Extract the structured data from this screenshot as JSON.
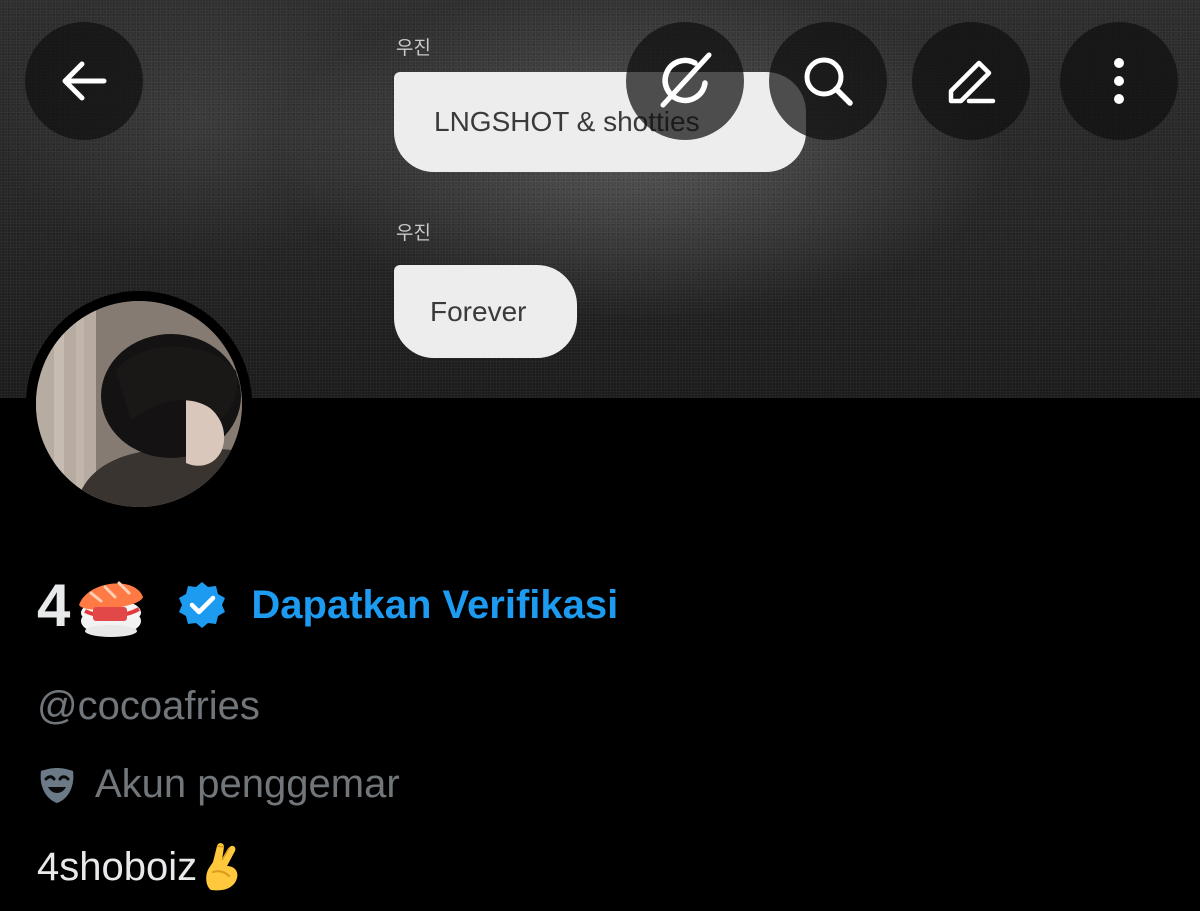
{
  "banner": {
    "messages": [
      {
        "sender": "우진",
        "text": "LNGSHOT & shotties"
      },
      {
        "sender": "우진",
        "text": "Forever"
      }
    ]
  },
  "nav": {
    "icons": [
      "back-arrow-icon",
      "grok-icon",
      "search-icon",
      "edit-icon",
      "more-vertical-icon"
    ]
  },
  "profile": {
    "display_name": "4",
    "name_emoji": "sushi",
    "verify_label": "Dapatkan Verifikasi",
    "handle": "@cocoafries",
    "category_label": "Akun penggemar",
    "bio": "4shoboiz",
    "bio_emoji": "crossed-fingers"
  },
  "colors": {
    "accent": "#1d9bf0",
    "secondary_text": "#71767b",
    "primary_text": "#e7e9ea",
    "background": "#000000"
  }
}
